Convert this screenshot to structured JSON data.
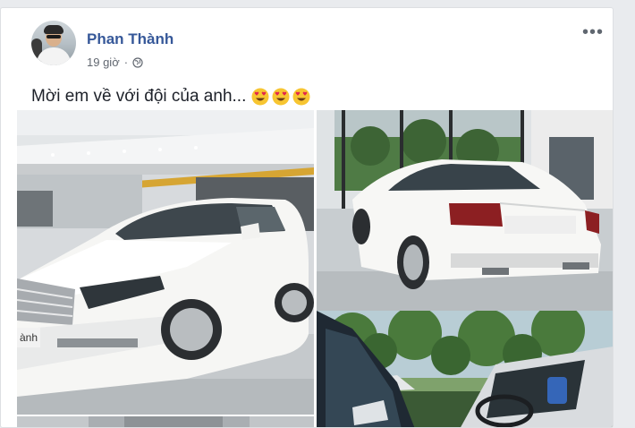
{
  "post": {
    "author": "Phan Thành",
    "time": "19 giờ",
    "separator": "·",
    "privacy_icon": "globe-icon",
    "more_icon": "more-options-icon",
    "more_label": "•••",
    "text": "Mời em về với đội của anh...",
    "emoji": [
      "heart-eyes-emoji",
      "heart-eyes-emoji",
      "heart-eyes-emoji"
    ]
  },
  "photos": [
    {
      "subject": "white-sedan-showroom-front",
      "sign_text": "ành"
    },
    {
      "subject": "white-sedan-showroom-rear"
    },
    {
      "subject": "car-interior-window-view"
    },
    {
      "subject": "showroom-ceiling"
    }
  ],
  "colors": {
    "link": "#365899",
    "text": "#1d2129",
    "meta": "#616770",
    "background": "#e9ebee"
  }
}
